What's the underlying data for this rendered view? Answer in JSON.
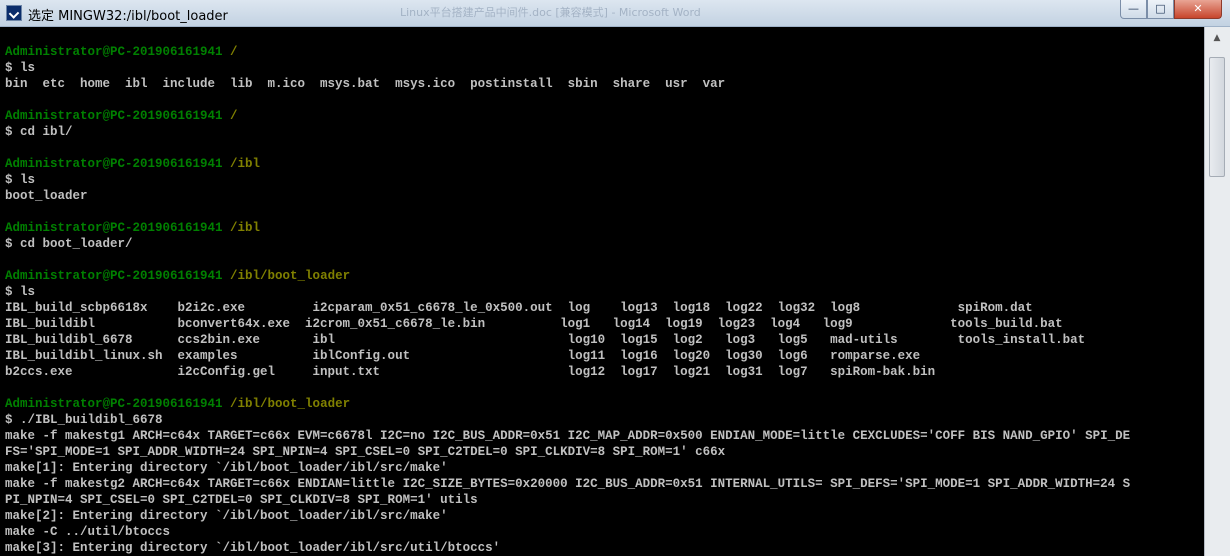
{
  "window": {
    "title": "选定 MINGW32:/ibl/boot_loader",
    "background_title": "Linux平台搭建产品中间件.doc [兼容模式] - Microsoft Word",
    "controls": {
      "minimize": "—",
      "maximize": "□",
      "close": "✕"
    }
  },
  "terminal": {
    "colors": {
      "background": "#000000",
      "text": "#c0c0c0",
      "user_host": "#008000",
      "path": "#808000"
    },
    "lines": {
      "l01": {
        "user": "Administrator@PC-201906161941",
        "path": " /"
      },
      "l02": "$ ls",
      "l03": "bin  etc  home  ibl  include  lib  m.ico  msys.bat  msys.ico  postinstall  sbin  share  usr  var",
      "l04": {
        "user": "Administrator@PC-201906161941",
        "path": " /"
      },
      "l05": "$ cd ibl/",
      "l06": {
        "user": "Administrator@PC-201906161941",
        "path": " /ibl"
      },
      "l07": "$ ls",
      "l08": "boot_loader",
      "l09": {
        "user": "Administrator@PC-201906161941",
        "path": " /ibl"
      },
      "l10": "$ cd boot_loader/",
      "l11": {
        "user": "Administrator@PC-201906161941",
        "path": " /ibl/boot_loader"
      },
      "l12": "$ ls",
      "l13": "IBL_build_scbp6618x    b2i2c.exe         i2cparam_0x51_c6678_le_0x500.out  log    log13  log18  log22  log32  log8             spiRom.dat",
      "l14": "IBL_buildibl           bconvert64x.exe  i2crom_0x51_c6678_le.bin          log1   log14  log19  log23  log4   log9             tools_build.bat",
      "l15": "IBL_buildibl_6678      ccs2bin.exe       ibl                               log10  log15  log2   log3   log5   mad-utils        tools_install.bat",
      "l16": "IBL_buildibl_linux.sh  examples          iblConfig.out                     log11  log16  log20  log30  log6   romparse.exe",
      "l17": "b2ccs.exe              i2cConfig.gel     input.txt                         log12  log17  log21  log31  log7   spiRom-bak.bin",
      "l18": {
        "user": "Administrator@PC-201906161941",
        "path": " /ibl/boot_loader"
      },
      "l19": "$ ./IBL_buildibl_6678",
      "l20": "make -f makestg1 ARCH=c64x TARGET=c66x EVM=c6678l I2C=no I2C_BUS_ADDR=0x51 I2C_MAP_ADDR=0x500 ENDIAN_MODE=little CEXCLUDES='COFF BIS NAND_GPIO' SPI_DE",
      "l21": "FS='SPI_MODE=1 SPI_ADDR_WIDTH=24 SPI_NPIN=4 SPI_CSEL=0 SPI_C2TDEL=0 SPI_CLKDIV=8 SPI_ROM=1' c66x",
      "l22": "make[1]: Entering directory `/ibl/boot_loader/ibl/src/make'",
      "l23": "make -f makestg2 ARCH=c64x TARGET=c66x ENDIAN=little I2C_SIZE_BYTES=0x20000 I2C_BUS_ADDR=0x51 INTERNAL_UTILS= SPI_DEFS='SPI_MODE=1 SPI_ADDR_WIDTH=24 S",
      "l24": "PI_NPIN=4 SPI_CSEL=0 SPI_C2TDEL=0 SPI_CLKDIV=8 SPI_ROM=1' utils",
      "l25": "make[2]: Entering directory `/ibl/boot_loader/ibl/src/make'",
      "l26": "make -C ../util/btoccs",
      "l27": "make[3]: Entering directory `/ibl/boot_loader/ibl/src/util/btoccs'"
    }
  },
  "scrollbar": {
    "up_arrow": "▲"
  }
}
